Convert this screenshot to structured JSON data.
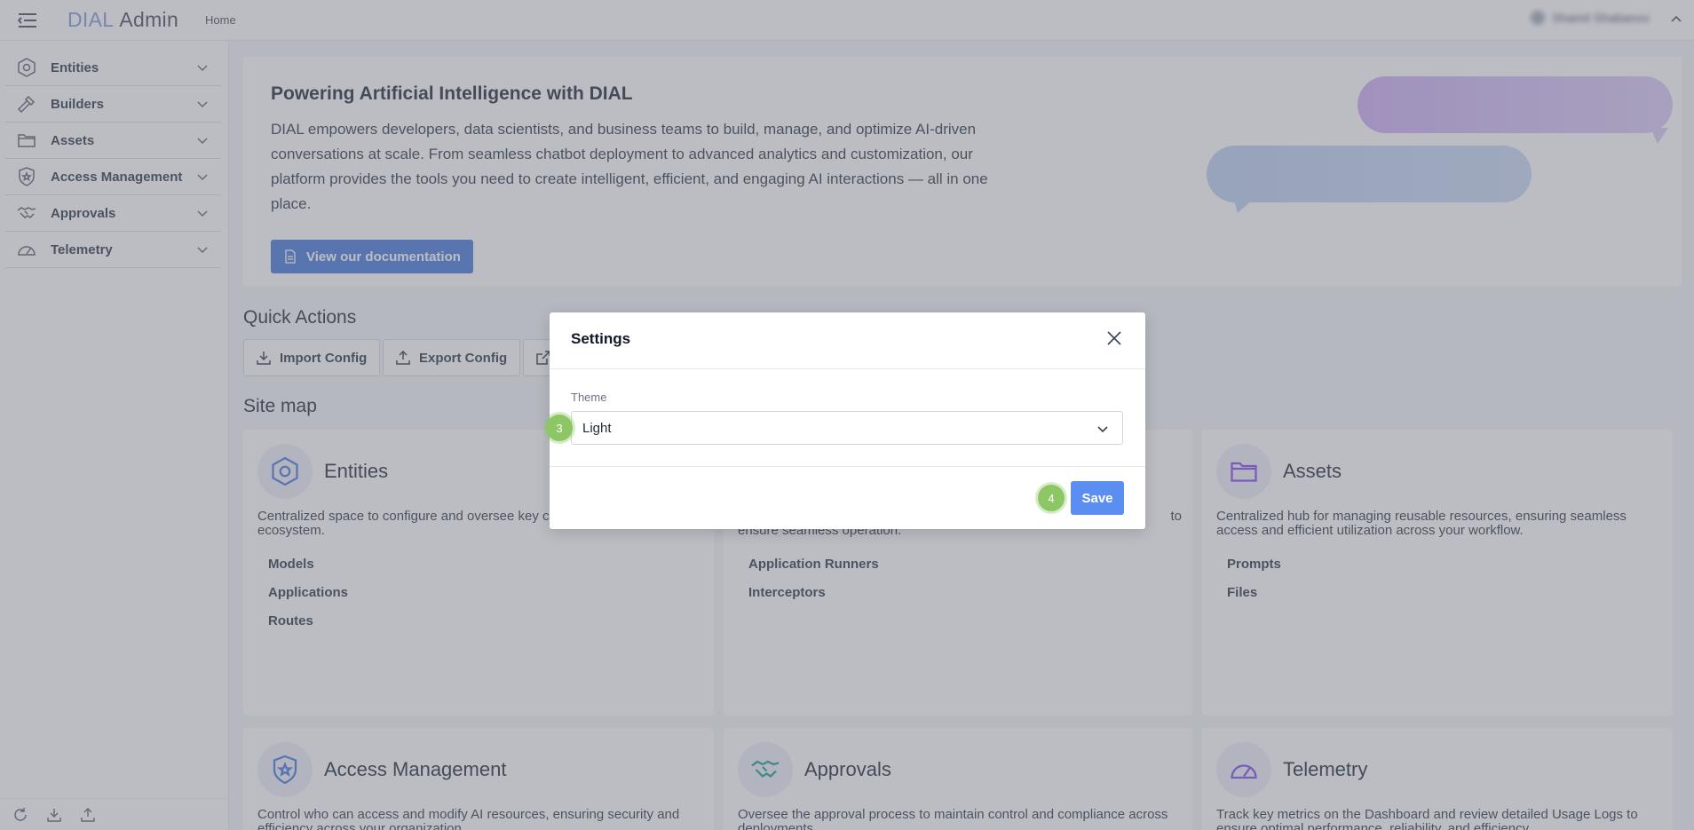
{
  "app": {
    "logo_primary": "DIAL",
    "logo_secondary": "Admin",
    "home_link": "Home",
    "user_name": "Shamil Shabanov"
  },
  "colors": {
    "primary": "#3b6fd9",
    "save_button": "#5b8ef0",
    "step_badge": "#8cc665",
    "overlay": "rgba(120,124,135,0.5)"
  },
  "sidebar": {
    "items": [
      {
        "label": "Entities",
        "icon": "hexagon-icon"
      },
      {
        "label": "Builders",
        "icon": "hammer-icon"
      },
      {
        "label": "Assets",
        "icon": "folder-icon"
      },
      {
        "label": "Access Management",
        "icon": "shield-star-icon"
      },
      {
        "label": "Approvals",
        "icon": "handshake-icon"
      },
      {
        "label": "Telemetry",
        "icon": "gauge-icon"
      }
    ],
    "footer_icons": [
      "refresh-icon",
      "download-icon",
      "upload-icon"
    ]
  },
  "hero": {
    "title": "Powering Artificial Intelligence with DIAL",
    "text": "DIAL empowers developers, data scientists, and business teams to build, manage, and optimize AI-driven conversations at scale. From seamless chatbot deployment to advanced analytics and customization, our platform provides the tools you need to create intelligent, efficient, and engaging AI interactions — all in one place.",
    "button": "View our documentation"
  },
  "quick_actions": {
    "title": "Quick Actions",
    "import": "Import Config",
    "export": "Export Config"
  },
  "site_map": {
    "title": "Site map",
    "cards": [
      {
        "title": "Entities",
        "desc": "Centralized space to configure and oversee key c",
        "desc2": "ecosystem.",
        "links": [
          "Models",
          "Applications",
          "Routes"
        ]
      },
      {
        "title": "",
        "desc": "to",
        "desc2": "ensure seamless operation.",
        "links": [
          "Application Runners",
          "Interceptors"
        ]
      },
      {
        "title": "Assets",
        "desc": "Centralized hub for managing reusable resources, ensuring seamless access and efficient utilization across your workflow.",
        "links": [
          "Prompts",
          "Files"
        ]
      },
      {
        "title": "Access Management",
        "desc": "Control who can access and modify AI resources, ensuring security and efficiency across your organization."
      },
      {
        "title": "Approvals",
        "desc": "Oversee the approval process to maintain control and compliance across deployments."
      },
      {
        "title": "Telemetry",
        "desc": "Track key metrics on the Dashboard and review detailed Usage Logs to ensure optimal performance, reliability, and efficiency."
      }
    ]
  },
  "modal": {
    "title": "Settings",
    "field_label": "Theme",
    "theme_value": "Light",
    "save": "Save"
  },
  "steps": {
    "theme_step": "3",
    "save_step": "4"
  }
}
